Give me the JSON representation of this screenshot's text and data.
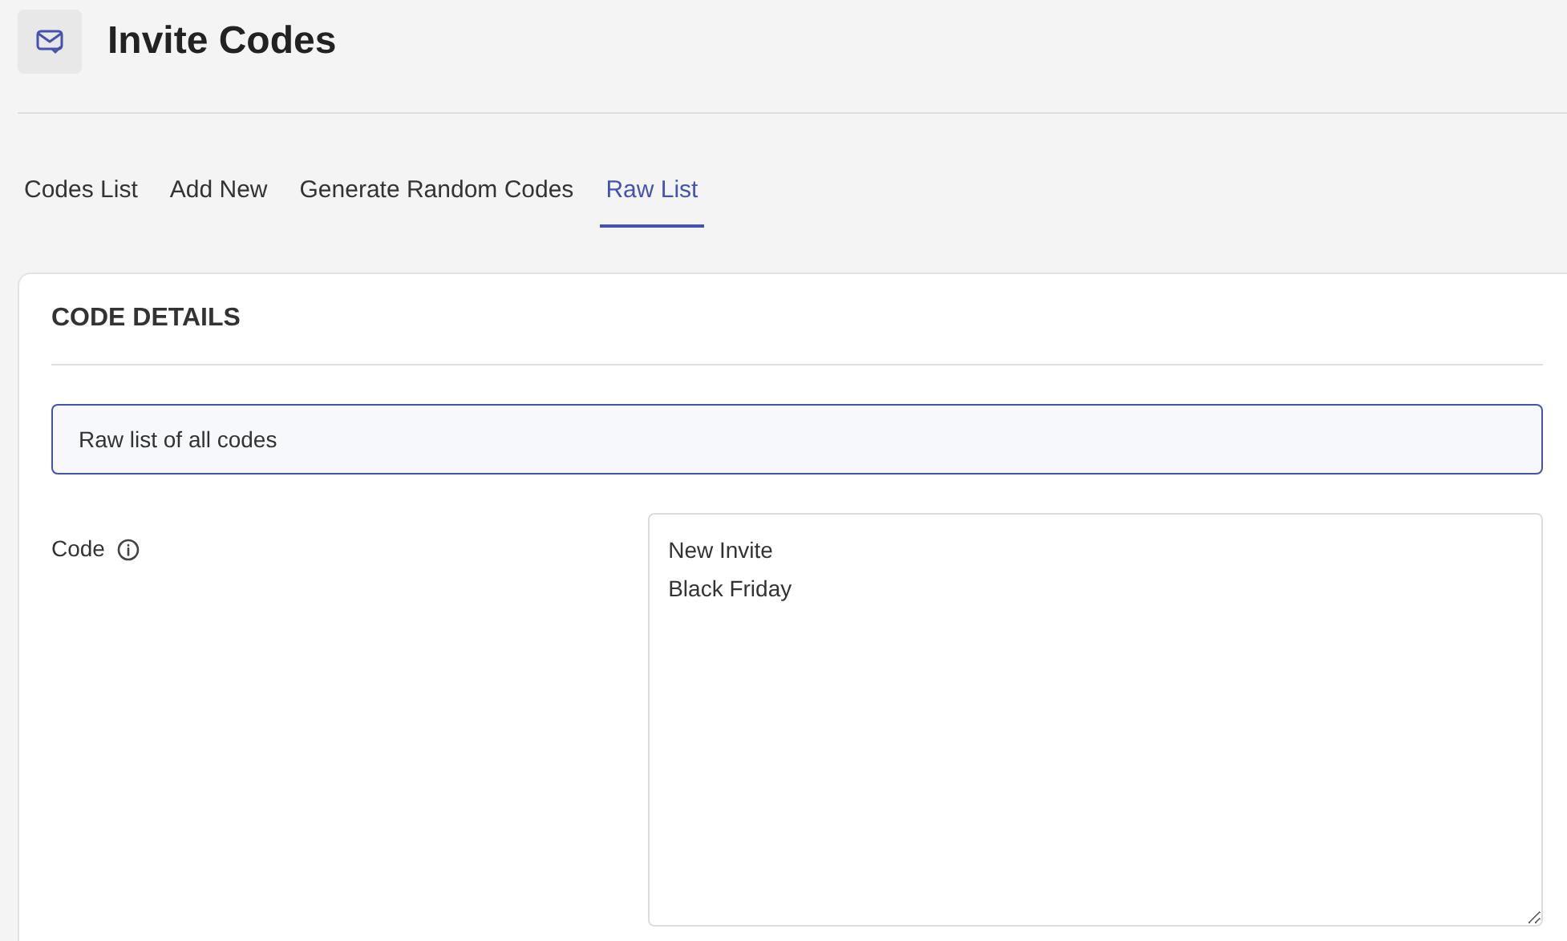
{
  "page": {
    "title": "Invite Codes"
  },
  "tabs": [
    {
      "label": "Codes List",
      "selected": false
    },
    {
      "label": "Add New",
      "selected": false
    },
    {
      "label": "Generate Random Codes",
      "selected": false
    },
    {
      "label": "Raw List",
      "selected": true
    }
  ],
  "card": {
    "heading": "CODE DETAILS",
    "notice": "Raw list of all codes",
    "field": {
      "label": "Code",
      "value": "New Invite\nBlack Friday"
    }
  }
}
